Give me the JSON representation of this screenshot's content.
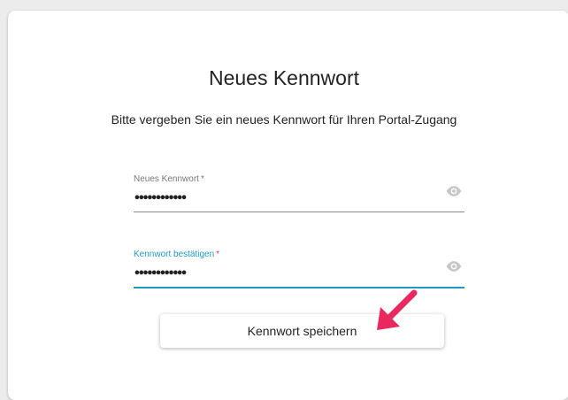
{
  "form": {
    "title": "Neues Kennwort",
    "subtitle": "Bitte vergeben Sie ein neues Kennwort für Ihren Portal-Zugang",
    "new_password": {
      "label": "Neues Kennwort",
      "required_mark": "*",
      "value": "••••••••••••"
    },
    "confirm_password": {
      "label": "Kennwort bestätigen",
      "required_mark": "*",
      "value": "••••••••••••"
    },
    "submit_label": "Kennwort speichern"
  },
  "colors": {
    "accent": "#1f9bc2",
    "required_active": "#e23a5a",
    "annotation_arrow": "#e8285e"
  },
  "icons": {
    "visibility": "eye-icon",
    "annotation": "pointer-arrow-icon"
  }
}
